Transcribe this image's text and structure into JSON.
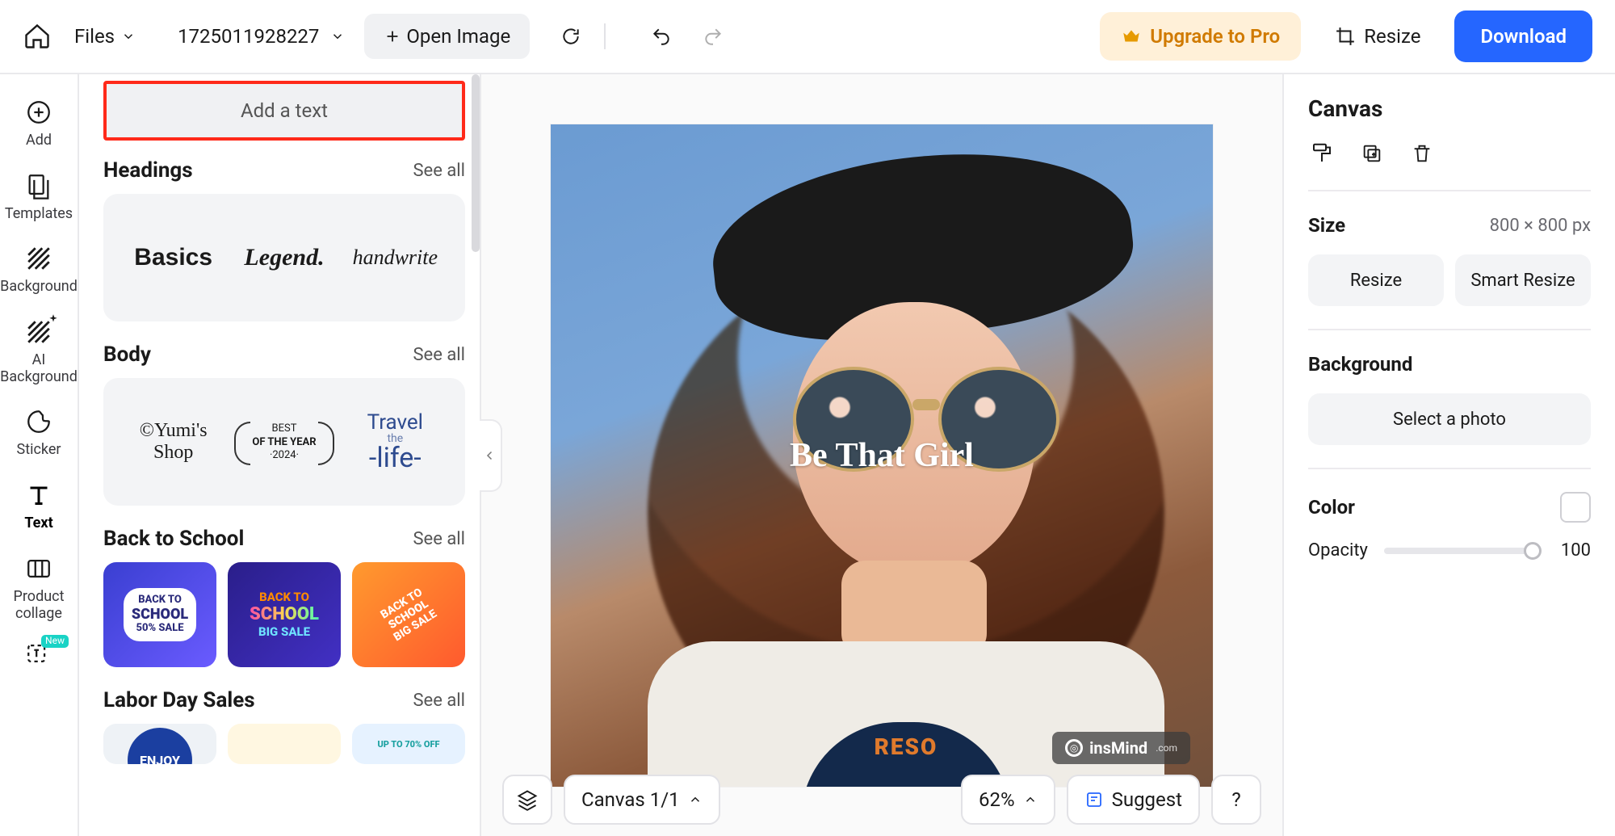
{
  "topbar": {
    "files_label": "Files",
    "doc_name": "1725011928227",
    "open_image_label": "Open Image",
    "upgrade_label": "Upgrade to Pro",
    "resize_label": "Resize",
    "download_label": "Download"
  },
  "rail": {
    "items": [
      {
        "label": "Add"
      },
      {
        "label": "Templates"
      },
      {
        "label": "Background"
      },
      {
        "label": "AI Background"
      },
      {
        "label": "Sticker"
      },
      {
        "label": "Text"
      },
      {
        "label": "Product collage"
      }
    ],
    "new_badge": "New"
  },
  "panel": {
    "add_text_label": "Add a text",
    "headings": {
      "title": "Headings",
      "see_all": "See all",
      "samples": [
        "Basics",
        "Legend.",
        "handwrite"
      ]
    },
    "body": {
      "title": "Body",
      "see_all": "See all",
      "samples": {
        "yumis": "©Yumi's Shop",
        "best_line1": "BEST",
        "best_line2": "OF THE YEAR",
        "best_year": "·2024·",
        "travel_top": "Travel",
        "travel_mid": "the",
        "travel_bottom": "-life-"
      }
    },
    "back_to_school": {
      "title": "Back to School",
      "see_all": "See all",
      "tiles": [
        {
          "line1": "BACK TO",
          "line2": "SCHOOL",
          "line3": "50% SALE"
        },
        {
          "line1": "BACK TO",
          "line2": "SCHOOL",
          "line3": "BIG SALE"
        },
        {
          "line1": "BACK TO",
          "line2": "SCHOOL",
          "line3": "BIG SALE"
        }
      ]
    },
    "labor": {
      "title": "Labor Day Sales",
      "see_all": "See all",
      "tiles": [
        "ENJOY",
        "",
        "UP TO 70% OFF"
      ]
    }
  },
  "canvas": {
    "overlay_text": "Be That Girl",
    "watermark_name": "insMind",
    "watermark_domain": ".com",
    "shirt_text": "RESO",
    "bottom": {
      "layers_tip": "Layers",
      "canvas_label": "Canvas 1/1",
      "zoom_label": "62%",
      "suggest_label": "Suggest",
      "help_label": "?"
    }
  },
  "inspector": {
    "title": "Canvas",
    "size_label": "Size",
    "size_value": "800 × 800 px",
    "resize_btn": "Resize",
    "smart_resize_btn": "Smart Resize",
    "background_label": "Background",
    "select_photo_btn": "Select a photo",
    "color_label": "Color",
    "opacity_label": "Opacity",
    "opacity_value": "100"
  }
}
